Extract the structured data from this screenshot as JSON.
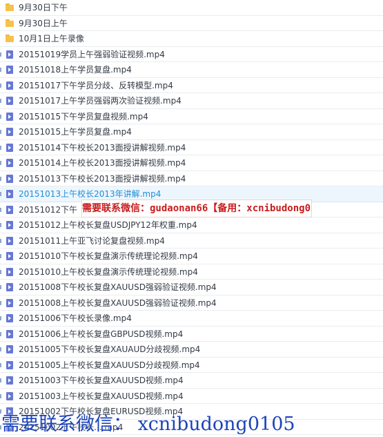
{
  "files": [
    {
      "name": "9月30日下午",
      "type": "folder"
    },
    {
      "name": "9月30日上午",
      "type": "folder"
    },
    {
      "name": "10月1日上午录像",
      "type": "folder"
    },
    {
      "name": "20151019学员上午强弱验证视频.mp4",
      "type": "video"
    },
    {
      "name": "20151018上午学员复盘.mp4",
      "type": "video"
    },
    {
      "name": "20151017下午学员分歧、反转模型.mp4",
      "type": "video"
    },
    {
      "name": "20151017上午学员强弱两次验证视频.mp4",
      "type": "video"
    },
    {
      "name": "20151015下午学员复盘视频.mp4",
      "type": "video"
    },
    {
      "name": "20151015上午学员复盘.mp4",
      "type": "video"
    },
    {
      "name": "20151014下午校长2013面授讲解视频.mp4",
      "type": "video"
    },
    {
      "name": "20151014上午校长2013面授讲解视频.mp4",
      "type": "video"
    },
    {
      "name": "20151013下午校长2013面授讲解视频.mp4",
      "type": "video"
    },
    {
      "name": "20151013上午校长2013年讲解.mp4",
      "type": "video",
      "selected": true
    },
    {
      "name": "20151012下午",
      "type": "video"
    },
    {
      "name": "20151012上午校长复盘USDJPY12年权重.mp4",
      "type": "video"
    },
    {
      "name": "20151011上午亚飞讨论复盘视频.mp4",
      "type": "video"
    },
    {
      "name": "20151010下午校长复盘演示传统理论视频.mp4",
      "type": "video"
    },
    {
      "name": "20151010上午校长复盘演示传统理论视频.mp4",
      "type": "video"
    },
    {
      "name": "20151008下午校长复盘XAUUSD强弱验证视频.mp4",
      "type": "video"
    },
    {
      "name": "20151008上午校长复盘XAUUSD强弱验证视频.mp4",
      "type": "video"
    },
    {
      "name": "20151006下午校长录像.mp4",
      "type": "video"
    },
    {
      "name": "20151006上午校长复盘GBPUSD视频.mp4",
      "type": "video"
    },
    {
      "name": "20151005下午校长复盘XAUAUD分歧视频.mp4",
      "type": "video"
    },
    {
      "name": "20151005上午校长复盘XAUUSD分歧视频.mp4",
      "type": "video"
    },
    {
      "name": "20151003下午校长复盘XAUUSD视频.mp4",
      "type": "video"
    },
    {
      "name": "20151003上午校长复盘XAUUSD视频.mp4",
      "type": "video"
    },
    {
      "name": "20151002下午校长复盘EURUSD视频.mp4",
      "type": "video"
    },
    {
      "name": "20151002上午校长....mp4",
      "type": "video"
    }
  ],
  "overlay_banner": {
    "text": "需要联系微信：gudaonan66【备用：xcnibudong0105】"
  },
  "footer_watermark": {
    "text": "需要联系微信： xcnibudong0105"
  },
  "colors": {
    "folder": "#f7c14a",
    "video": "#6678d6",
    "selected_text": "#1a8fd8",
    "banner_text": "#c91c1c",
    "watermark_text": "#1c44ba"
  }
}
